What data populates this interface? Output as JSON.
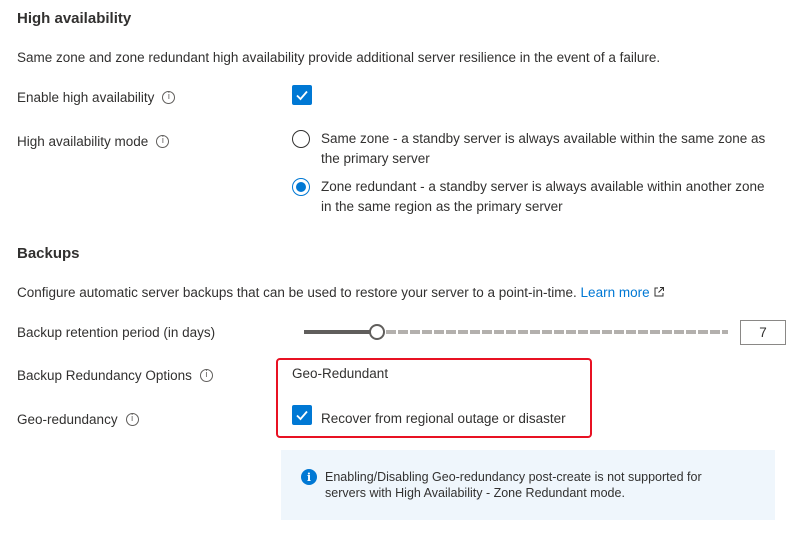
{
  "high_availability": {
    "title": "High availability",
    "description": "Same zone and zone redundant high availability provide additional server resilience in the event of a failure.",
    "enable_label": "Enable high availability",
    "enable_checked": true,
    "mode_label": "High availability mode",
    "mode_options": [
      {
        "label": "Same zone - a standby server is always available within the same zone as the primary server",
        "checked": false
      },
      {
        "label": "Zone redundant - a standby server is always available within another zone in the same region as the primary server",
        "checked": true
      }
    ]
  },
  "backups": {
    "title": "Backups",
    "description": "Configure automatic server backups that can be used to restore your server to a point-in-time.",
    "learn_more": "Learn more",
    "retention_label": "Backup retention period (in days)",
    "retention_value": "7",
    "retention_fraction": 0.17,
    "redundancy_label": "Backup Redundancy Options",
    "redundancy_value": "Geo-Redundant",
    "geo_label": "Geo-redundancy",
    "geo_checkbox_label": "Recover from regional outage or disaster",
    "geo_checked": true,
    "info_message": "Enabling/Disabling Geo-redundancy post-create is not supported for servers with High Availability - Zone Redundant mode."
  },
  "colors": {
    "accent": "#0078d4",
    "highlight": "#e81123",
    "info_background": "#eff6fc"
  }
}
